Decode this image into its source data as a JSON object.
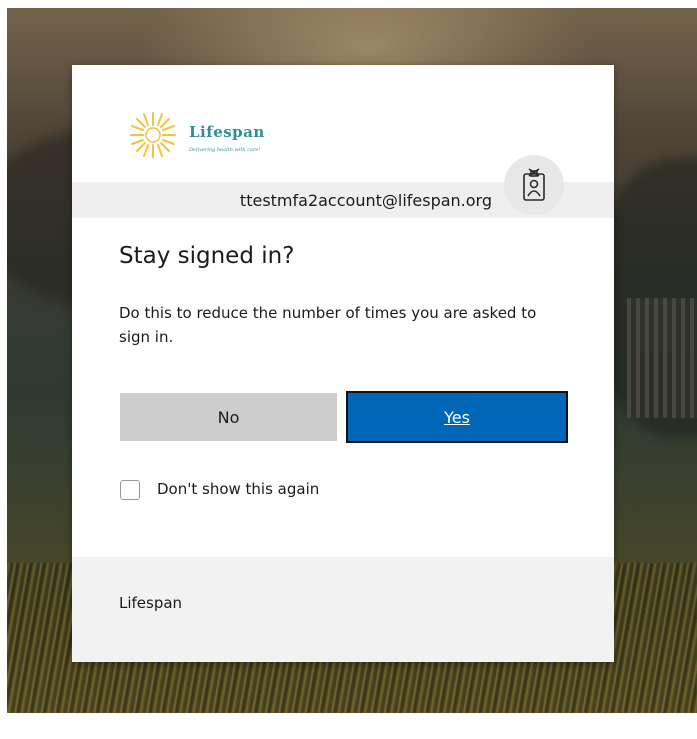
{
  "organization": {
    "brand_name": "Lifespan",
    "tagline": "Delivering health with care!"
  },
  "account": {
    "email": "ttestmfa2account@lifespan.org"
  },
  "dialog": {
    "title": "Stay signed in?",
    "description": "Do this to reduce the number of times you are asked to sign in.",
    "no_label": "No",
    "yes_label": "Yes",
    "checkbox_label": "Don't show this again",
    "checkbox_checked": false
  },
  "footer": {
    "text": "Lifespan"
  },
  "colors": {
    "accent": "#0067b8",
    "brand_teal": "#2f8f95",
    "sun_yellow": "#f5c242"
  },
  "icons": {
    "avatar": "badge-person-icon",
    "logo": "sun-logo-icon"
  }
}
